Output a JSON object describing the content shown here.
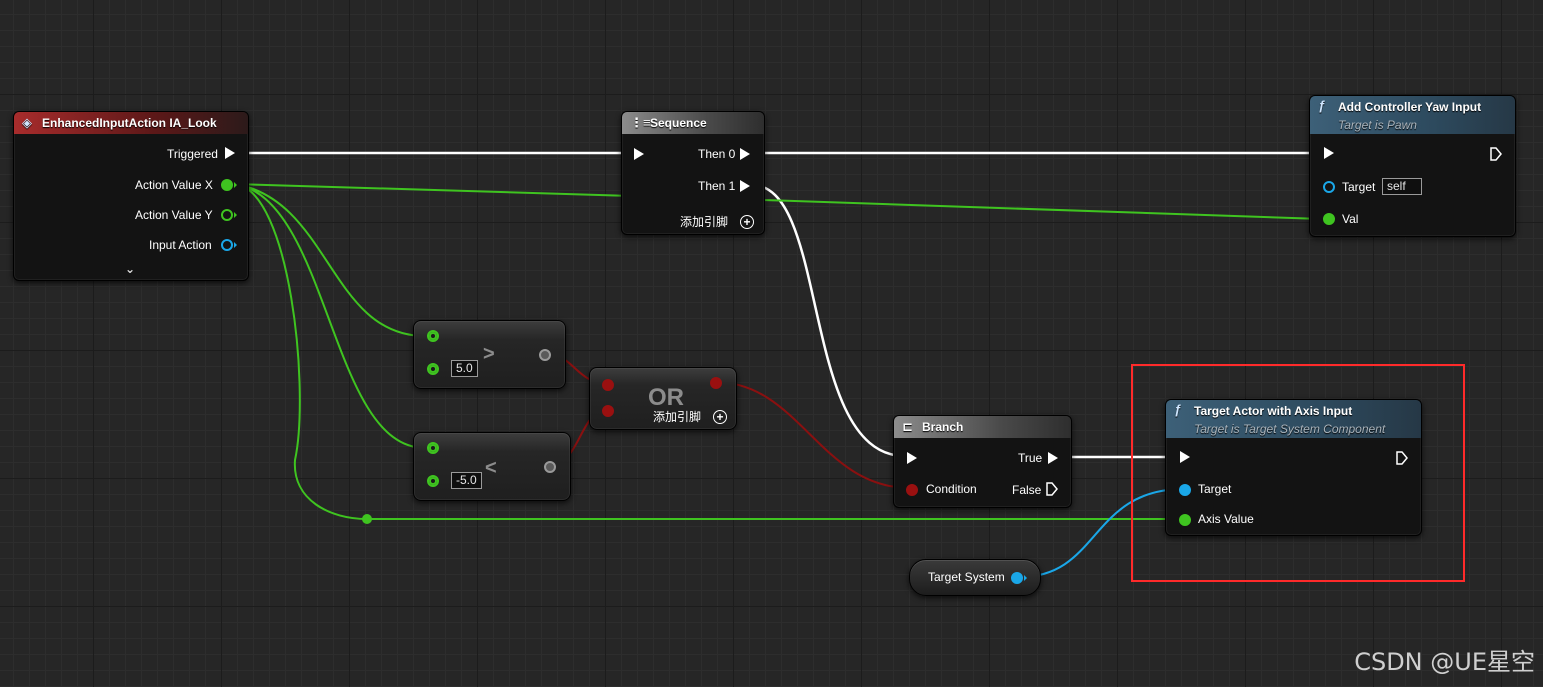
{
  "graph": {
    "event_node": {
      "title": "EnhancedInputAction IA_Look",
      "icon": "event-diamond-icon",
      "pins": {
        "triggered": "Triggered",
        "action_value_x": "Action Value X",
        "action_value_y": "Action Value Y",
        "input_action": "Input Action"
      },
      "expand_icon": "chevron-down-icon"
    },
    "sequence_node": {
      "title": "Sequence",
      "icon": "sequence-icon",
      "pins": {
        "then0": "Then 0",
        "then1": "Then 1"
      },
      "add_pin": "添加引脚"
    },
    "yaw_node": {
      "title": "Add Controller Yaw Input",
      "subtitle": "Target is Pawn",
      "icon": "function-icon",
      "pins": {
        "target": "Target",
        "target_default": "self",
        "val": "Val"
      }
    },
    "greater_node": {
      "operator": ">",
      "b_value": "5.0"
    },
    "less_node": {
      "operator": "<",
      "b_value": "-5.0"
    },
    "or_node": {
      "operator": "OR",
      "add_pin": "添加引脚"
    },
    "branch_node": {
      "title": "Branch",
      "icon": "branch-icon",
      "pins": {
        "condition": "Condition",
        "true": "True",
        "false": "False"
      }
    },
    "target_node": {
      "title": "Target Actor with Axis Input",
      "subtitle": "Target is Target System Component",
      "icon": "function-icon",
      "pins": {
        "target": "Target",
        "axis_value": "Axis Value"
      }
    },
    "get_node": {
      "label": "Target System"
    }
  },
  "colors": {
    "exec_wire": "#ffffff",
    "float_wire": "#3fc420",
    "bool_wire": "#8a1010",
    "object_wire": "#1aa7e8",
    "highlight": "#ff2a2a"
  },
  "watermark": "CSDN @UE星空"
}
